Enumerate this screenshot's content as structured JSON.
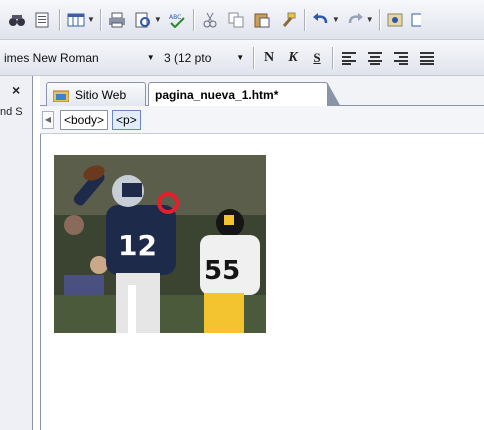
{
  "toolbar_font": {
    "font_name": "imes New Roman",
    "font_size": "3  (12 pto",
    "bold_label": "N",
    "italic_label": "K",
    "strike_label": "S"
  },
  "left_panel": {
    "close_label": "×",
    "label": "nd S"
  },
  "tabs": [
    {
      "label": "Sitio Web"
    },
    {
      "label": "pagina_nueva_1.htm*"
    }
  ],
  "tag_selector": {
    "tags": [
      "<body>",
      "<p>"
    ]
  },
  "colors": {
    "toolbar": "#dfe3ec",
    "accent": "#6b86c4",
    "jersey_navy": "#1e2a4a",
    "jersey_yellow": "#f4c430"
  },
  "image": {
    "subject": "football-photo"
  }
}
